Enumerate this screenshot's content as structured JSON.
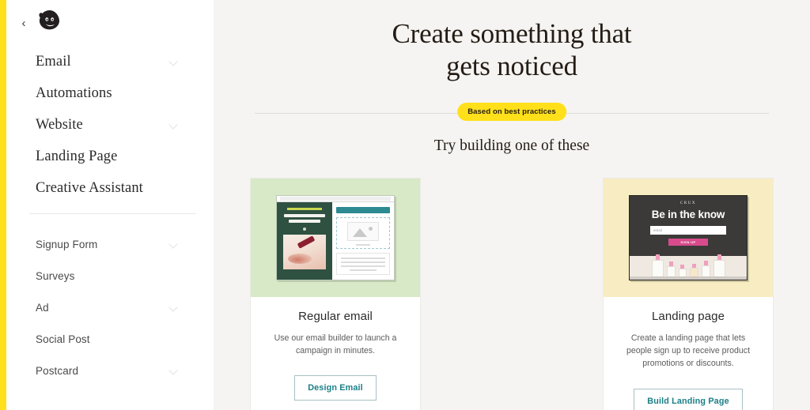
{
  "sidebar": {
    "collapse_label": "‹",
    "logo_name": "mailchimp-freddie-logo",
    "primary_items": [
      {
        "label": "Email",
        "chevron": true
      },
      {
        "label": "Automations",
        "chevron": false
      },
      {
        "label": "Website",
        "chevron": true
      },
      {
        "label": "Landing Page",
        "chevron": false
      },
      {
        "label": "Creative Assistant",
        "chevron": false
      }
    ],
    "secondary_items": [
      {
        "label": "Signup Form",
        "chevron": true
      },
      {
        "label": "Surveys",
        "chevron": false
      },
      {
        "label": "Ad",
        "chevron": true
      },
      {
        "label": "Social Post",
        "chevron": false
      },
      {
        "label": "Postcard",
        "chevron": true
      }
    ]
  },
  "hero": {
    "title_line1": "Create something that",
    "title_line2": "gets noticed",
    "badge": "Based on best practices",
    "subhead": "Try building one of these"
  },
  "cards": [
    {
      "title": "Regular email",
      "description": "Use our email builder to launch a campaign in minutes.",
      "button": "Design Email",
      "thumb_bg": "#d7e9c6",
      "art": {
        "kind": "email-builder-mockup",
        "preview_eyebrow": "INTRODUCING OUR NEW CO.",
        "preview_headline": "We've redefined refreshment"
      }
    },
    {
      "title": "Landing page",
      "description": "Create a landing page that lets people sign up to receive product promotions or discounts.",
      "button": "Build Landing Page",
      "thumb_bg": "#f8edc2",
      "art": {
        "kind": "landing-page-mockup",
        "brand": "CRUX",
        "headline": "Be in the know",
        "input_placeholder": "email",
        "cta": "SIGN UP"
      }
    }
  ],
  "colors": {
    "accent_yellow": "#ffe01b",
    "page_bg": "#f5f4f2",
    "teal": "#1a7f86",
    "text_dark": "#241c15"
  }
}
